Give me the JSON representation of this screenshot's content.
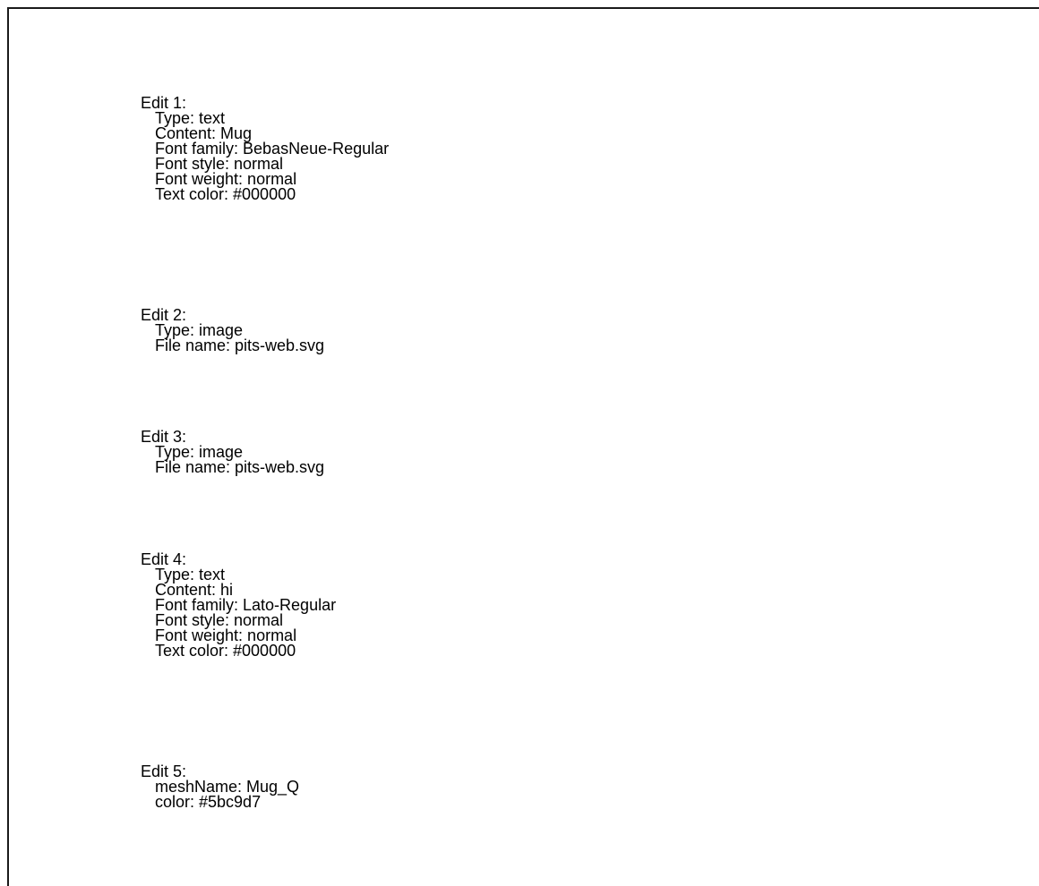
{
  "edits": [
    {
      "heading": "Edit 1:",
      "lines": [
        "Type: text",
        "Content: Mug",
        "Font family: BebasNeue-Regular",
        "Font style: normal",
        "Font weight: normal",
        "Text color: #000000"
      ]
    },
    {
      "heading": "Edit 2:",
      "lines": [
        "Type: image",
        "File name: pits-web.svg"
      ]
    },
    {
      "heading": "Edit 3:",
      "lines": [
        "Type: image",
        "File name: pits-web.svg"
      ]
    },
    {
      "heading": "Edit 4:",
      "lines": [
        "Type: text",
        "Content: hi",
        "Font family: Lato-Regular",
        "Font style: normal",
        "Font weight: normal",
        "Text color: #000000"
      ]
    },
    {
      "heading": "Edit 5:",
      "lines": [
        "meshName: Mug_Q",
        "color: #5bc9d7"
      ]
    }
  ]
}
